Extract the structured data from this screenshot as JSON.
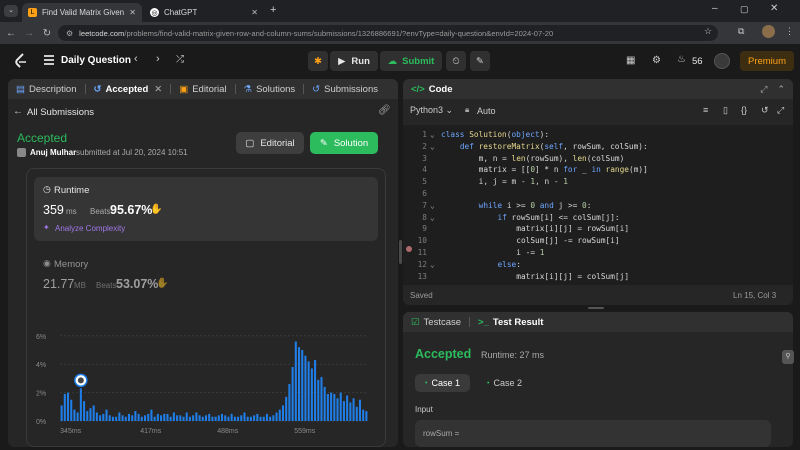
{
  "browser": {
    "tabs": [
      {
        "title": "Find Valid Matrix Given Row an",
        "active": true
      },
      {
        "title": "ChatGPT",
        "active": false
      }
    ],
    "url_host": "leetcode.com",
    "url_path": "/problems/find-valid-matrix-given-row-and-column-sums/submissions/1326886691/?envType=daily-question&envId=2024-07-20"
  },
  "header": {
    "daily_question": "Daily Question",
    "run_label": "Run",
    "submit_label": "Submit",
    "streak": "56",
    "premium_label": "Premium"
  },
  "left_tabs": [
    {
      "label": "Description"
    },
    {
      "label": "Accepted"
    },
    {
      "label": "Editorial"
    },
    {
      "label": "Solutions"
    },
    {
      "label": "Submissions"
    }
  ],
  "submission": {
    "all_submissions": "All Submissions",
    "status": "Accepted",
    "user": "Anuj Mulhar",
    "submitted_text": "submitted at Jul 20, 2024 10:51",
    "editorial_btn": "Editorial",
    "solution_btn": "Solution",
    "runtime_label": "Runtime",
    "runtime_value": "359",
    "runtime_unit": "ms",
    "beats_label": "Beats",
    "runtime_beats": "95.67%",
    "analyze_label": "Analyze Complexity",
    "memory_label": "Memory",
    "memory_value": "21.77",
    "memory_unit": "MB",
    "memory_beats": "53.07%"
  },
  "chart_data": {
    "type": "bar",
    "y_ticks": [
      "6%",
      "4%",
      "2%",
      "0%"
    ],
    "x_ticks": [
      "345ms",
      "417ms",
      "488ms",
      "559ms"
    ],
    "ylim": [
      0,
      6.9
    ],
    "values": [
      1.1,
      1.9,
      2.0,
      1.5,
      0.8,
      0.6,
      2.3,
      1.4,
      0.7,
      0.9,
      1.1,
      0.6,
      0.4,
      0.5,
      0.8,
      0.4,
      0.3,
      0.3,
      0.6,
      0.4,
      0.3,
      0.5,
      0.4,
      0.7,
      0.5,
      0.3,
      0.4,
      0.5,
      0.8,
      0.3,
      0.5,
      0.4,
      0.5,
      0.5,
      0.3,
      0.6,
      0.4,
      0.4,
      0.3,
      0.6,
      0.3,
      0.4,
      0.6,
      0.4,
      0.3,
      0.4,
      0.5,
      0.3,
      0.3,
      0.4,
      0.5,
      0.4,
      0.3,
      0.5,
      0.3,
      0.3,
      0.4,
      0.6,
      0.3,
      0.3,
      0.4,
      0.5,
      0.3,
      0.3,
      0.5,
      0.3,
      0.4,
      0.6,
      0.8,
      1.1,
      1.7,
      2.6,
      3.8,
      5.6,
      5.2,
      5.0,
      4.6,
      4.2,
      3.7,
      4.3,
      2.9,
      3.1,
      2.4,
      1.9,
      2.0,
      1.9,
      1.6,
      2.0,
      1.4,
      1.8,
      1.3,
      1.6,
      1.0,
      1.5,
      0.8,
      0.7
    ]
  },
  "code_panel": {
    "title": "Code",
    "language": "Python3",
    "mode": "Auto",
    "lines": [
      "class Solution(object):",
      "    def restoreMatrix(self, rowSum, colSum):",
      "        m, n = len(rowSum), len(colSum)",
      "        matrix = [[0] * n for _ in range(m)]",
      "        i, j = m - 1, n - 1",
      "",
      "        while i >= 0 and j >= 0:",
      "            if rowSum[i] <= colSum[j]:",
      "                matrix[i][j] = rowSum[i]",
      "                colSum[j] -= rowSum[i]",
      "                i -= 1",
      "            else:",
      "                matrix[i][j] = colSum[j]"
    ],
    "status": "Saved",
    "cursor": "Ln 15, Col 3"
  },
  "result_panel": {
    "tab_testcase": "Testcase",
    "tab_result": "Test Result",
    "status": "Accepted",
    "runtime_text": "Runtime: 27 ms",
    "case1": "Case 1",
    "case2": "Case 2",
    "input_label": "Input",
    "input_var": "rowSum ="
  },
  "colors": {
    "accent_green": "#2cbb5d",
    "runtime_beats": "#ffffff",
    "chart_blue": "#1f7ee8",
    "premium_orange": "#ffa116"
  }
}
